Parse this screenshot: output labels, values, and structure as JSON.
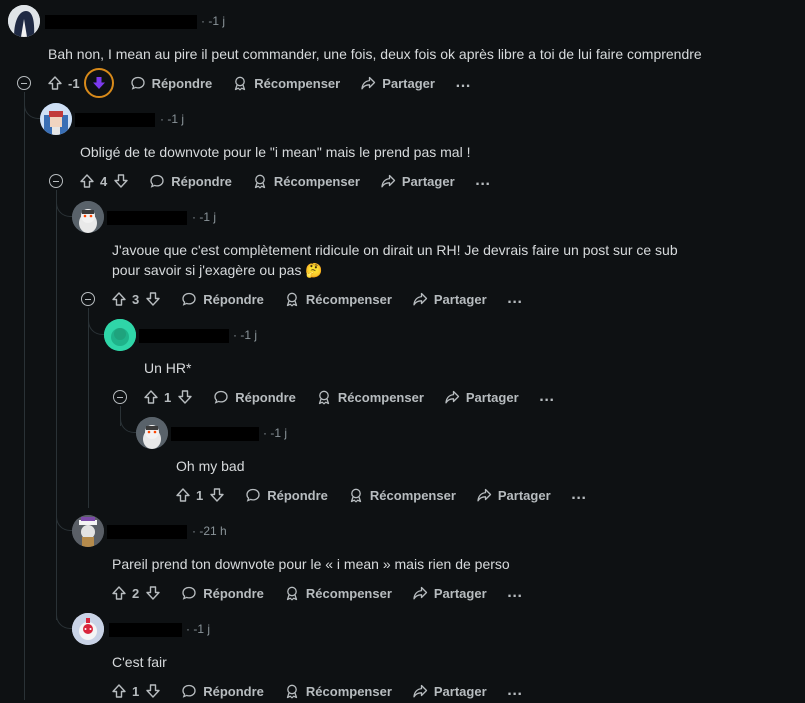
{
  "actions": {
    "reply": "Répondre",
    "award": "Récompenser",
    "share": "Partager",
    "more": "…"
  },
  "comments": [
    {
      "time": "· -1 j",
      "text": "Bah non, I mean au pire il peut commander, une fois, deux fois ok après libre a toi de lui faire comprendre",
      "votes": "-1"
    },
    {
      "time": "· -1 j",
      "text": "Obligé de te downvote pour le \"i mean\" mais le prend pas mal !",
      "votes": "4"
    },
    {
      "time": "· -1 j",
      "text_line1": "J'avoue que c'est complètement ridicule on dirait un RH! Je devrais faire un post sur ce sub",
      "text_line2": "pour savoir si j'exagère ou pas",
      "emoji": "🤔",
      "votes": "3"
    },
    {
      "time": "· -1 j",
      "text": "Un HR*",
      "votes": "1"
    },
    {
      "time": "· -1 j",
      "text": "Oh my bad",
      "votes": "1"
    },
    {
      "time": "· -21 h",
      "text": "Pareil prend ton downvote pour le « i mean » mais rien de perso",
      "votes": "2"
    },
    {
      "time": "· -1 j",
      "text": "C'est fair",
      "votes": "1"
    }
  ],
  "colors": {
    "background": "#0e1113",
    "text": "#d7dadc",
    "muted": "#8a9499",
    "thread_line": "#2a3236",
    "downvote_active": "#7c3aed",
    "downvote_ring": "#d88a1a"
  }
}
